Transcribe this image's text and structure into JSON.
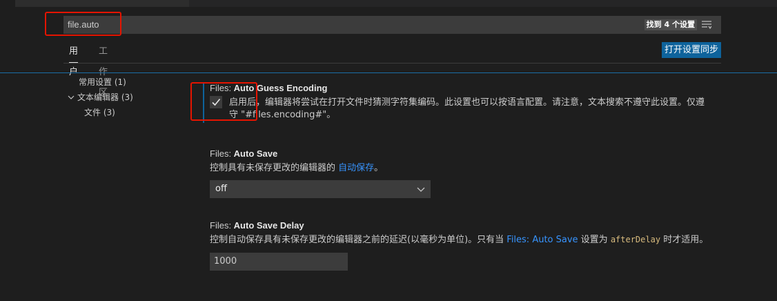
{
  "search": {
    "value": "file.auto",
    "result_count": "找到 4 个设置"
  },
  "scope_tabs": [
    {
      "label": "用户",
      "active": true
    },
    {
      "label": "工作区",
      "active": false
    }
  ],
  "sync_button_label": "打开设置同步",
  "toc": [
    {
      "label": "常用设置",
      "count": "(1)",
      "expanded": null
    },
    {
      "label": "文本编辑器",
      "count": "(3)",
      "expanded": true
    },
    {
      "label": "文件",
      "count": "(3)",
      "expanded": null
    }
  ],
  "settings": {
    "auto_guess_encoding": {
      "category": "Files: ",
      "name": "Auto Guess Encoding",
      "checked": true,
      "description": "启用后，编辑器将尝试在打开文件时猜测字符集编码。此设置也可以按语言配置。请注意，文本搜索不遵守此设置。仅遵守 \"#files.encoding#\"。"
    },
    "auto_save": {
      "category": "Files: ",
      "name": "Auto Save",
      "description_prefix": "控制具有未保存更改的编辑器的 ",
      "description_link": "自动保存",
      "description_suffix": "。",
      "selected_value": "off"
    },
    "auto_save_delay": {
      "category": "Files: ",
      "name": "Auto Save Delay",
      "description_prefix": "控制自动保存具有未保存更改的编辑器之前的延迟(以毫秒为单位)。只有当 ",
      "description_link": "Files: Auto Save",
      "description_middle": " 设置为 ",
      "description_code": "afterDelay",
      "description_suffix": " 时才适用。",
      "value": "1000"
    }
  },
  "colors": {
    "accent": "#0e639c",
    "link": "#3794ff",
    "highlight": "#e51400"
  }
}
